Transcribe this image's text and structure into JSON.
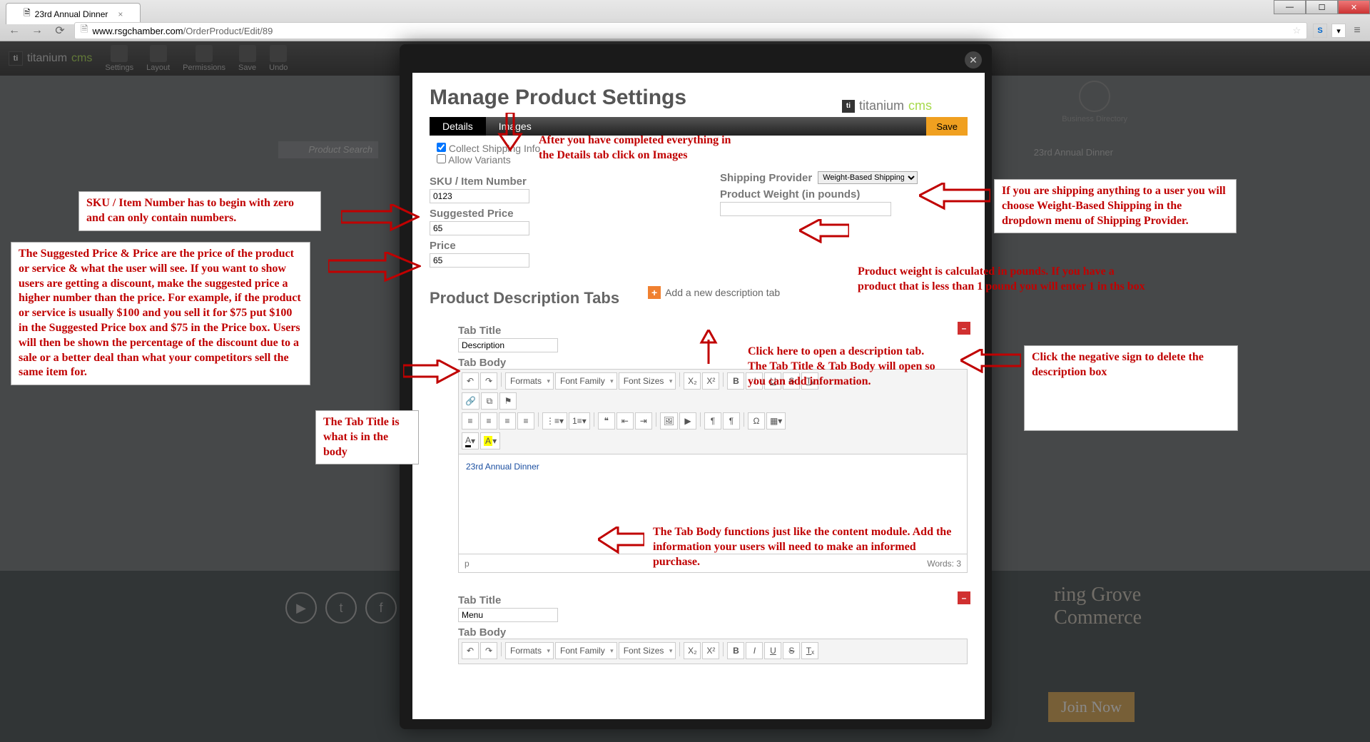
{
  "browser": {
    "tab_title": "23rd Annual Dinner",
    "url_host": "www.rsgchamber.com",
    "url_path": "/OrderProduct/Edit/89"
  },
  "cms_toolbar": {
    "brand1": "titanium",
    "brand2": "cms",
    "tools": [
      "Settings",
      "Layout",
      "Permissions",
      "Save",
      "Undo"
    ]
  },
  "background": {
    "search_placeholder": "Product Search",
    "biz_dir": "Business Directory",
    "breadcrumb": "23rd Annual Dinner",
    "org_line1": "ring Grove",
    "org_line2": "Commerce",
    "join": "Join Now"
  },
  "modal": {
    "title": "Manage Product Settings",
    "logo1": "titanium",
    "logo2": "cms",
    "tabs": {
      "details": "Details",
      "images": "Images",
      "save": "Save"
    },
    "collect_shipping": "Collect Shipping Info",
    "allow_variants": "Allow Variants",
    "sku_label": "SKU / Item Number",
    "sku_value": "0123",
    "suggested_label": "Suggested Price",
    "suggested_value": "65",
    "price_label": "Price",
    "price_value": "65",
    "shipping_provider_label": "Shipping Provider",
    "shipping_provider_value": "Weight-Based Shipping",
    "weight_label": "Product Weight (in pounds)",
    "weight_value": "",
    "section": "Product Description Tabs",
    "add_tab": "Add a new description tab",
    "tab1": {
      "title_label": "Tab Title",
      "title_value": "Description",
      "body_label": "Tab Body",
      "body_text": "23rd Annual Dinner",
      "status_path": "p",
      "status_words": "Words: 3"
    },
    "tab2": {
      "title_label": "Tab Title",
      "title_value": "Menu",
      "body_label": "Tab Body"
    },
    "rte": {
      "formats": "Formats",
      "font_family": "Font Family",
      "font_sizes": "Font Sizes"
    }
  },
  "callouts": {
    "images_tab": "After you have completed everything in the Details tab click on Images",
    "sku": "SKU / Item Number has to begin with zero and can only contain numbers.",
    "price": "The Suggested Price & Price are the price of the product or service & what the user will see. If you want to show users are getting a discount, make the suggested price a higher number than the price. For example, if the product or service is usually $100 and you sell it for $75 put $100 in the Suggested Price box and $75 in the Price box. Users will then be shown the percentage of the discount due to a sale or a better deal than what your competitors sell the same item for.",
    "shipping": "If you are shipping anything to a user you will choose Weight-Based Shipping in the dropdown menu of Shipping Provider.",
    "weight": "Product weight is calculated in pounds. If you have a product that is less than 1 pound you will enter 1 in ths box",
    "add_tab": "Click here to open a description tab. The Tab Title & Tab Body will open so you can add information.",
    "minus": "Click the negative sign to delete the description box",
    "tab_title": "The Tab Title is what is in the body",
    "tab_body": "The Tab Body functions just like the content module. Add the information your users will need to make an informed purchase."
  }
}
